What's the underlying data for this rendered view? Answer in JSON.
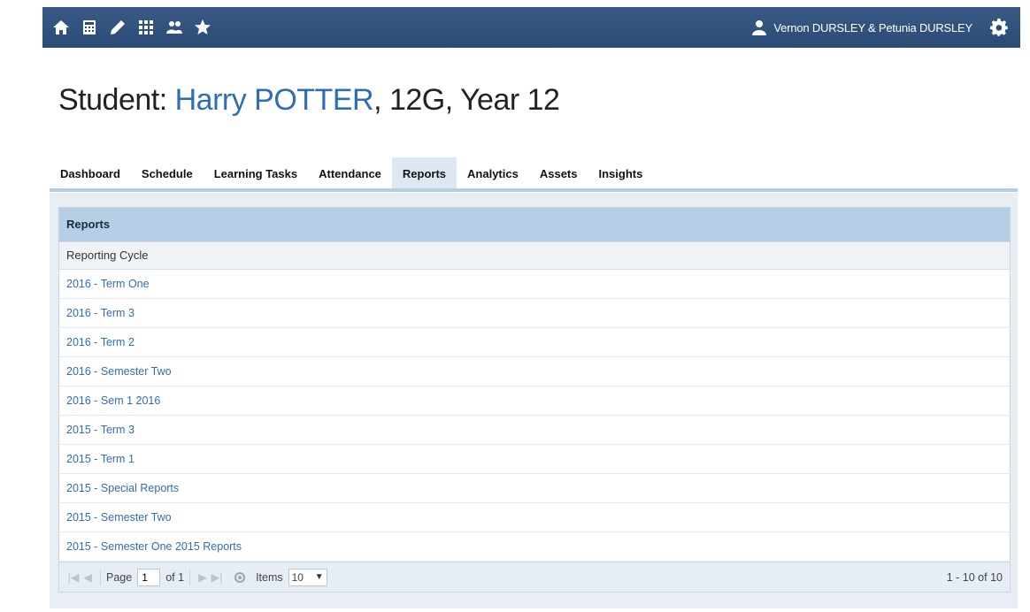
{
  "nav": {
    "icons": [
      "home-icon",
      "calculator-icon",
      "pencil-icon",
      "grid-icon",
      "people-icon",
      "star-icon"
    ],
    "user_name": "Vernon DURSLEY & Petunia DURSLEY"
  },
  "title": {
    "prefix": "Student: ",
    "student": "Harry POTTER",
    "suffix": ", 12G, Year 12"
  },
  "tabs": [
    {
      "label": "Dashboard"
    },
    {
      "label": "Schedule"
    },
    {
      "label": "Learning Tasks"
    },
    {
      "label": "Attendance"
    },
    {
      "label": "Reports",
      "active": true
    },
    {
      "label": "Analytics"
    },
    {
      "label": "Assets"
    },
    {
      "label": "Insights"
    }
  ],
  "grid": {
    "title": "Reports",
    "column": "Reporting Cycle",
    "rows": [
      "2016 - Term One",
      "2016 - Term 3",
      "2016 - Term 2",
      "2016 - Semester Two",
      "2016 - Sem 1 2016",
      "2015 - Term 3",
      "2015 - Term 1",
      "2015 - Special Reports",
      "2015 - Semester Two",
      "2015 - Semester One 2015 Reports"
    ]
  },
  "pager": {
    "page_label": "Page",
    "page_value": "1",
    "of_label": "of 1",
    "items_label": "Items",
    "items_value": "10",
    "info": "1 - 10 of 10"
  },
  "colors": {
    "accent": "#2f6eb6",
    "topbar": "#2f4f7d"
  }
}
